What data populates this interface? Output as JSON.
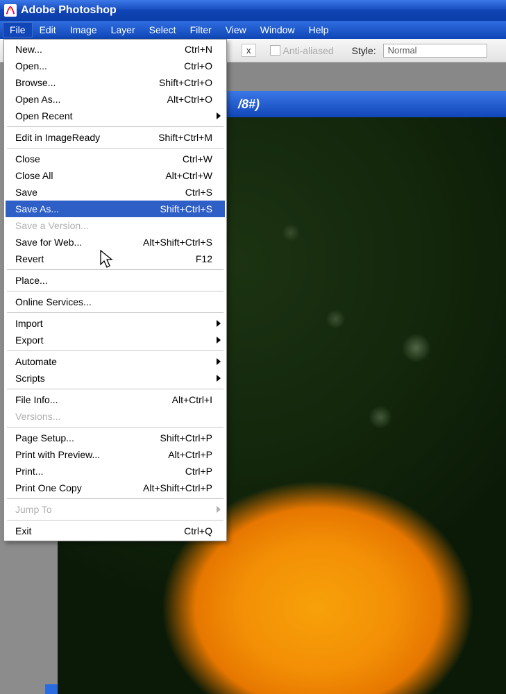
{
  "app": {
    "title": "Adobe Photoshop"
  },
  "menubar": {
    "items": [
      "File",
      "Edit",
      "Image",
      "Layer",
      "Select",
      "Filter",
      "View",
      "Window",
      "Help"
    ],
    "open_index": 0
  },
  "options": {
    "px_suffix": "x",
    "anti_aliased_label": "Anti-aliased",
    "anti_aliased_checked": false,
    "style_label": "Style:",
    "style_value": "Normal"
  },
  "document": {
    "tab_visible_text": "/8#)"
  },
  "file_menu": {
    "groups": [
      [
        {
          "label": "New...",
          "shortcut": "Ctrl+N",
          "submenu": false,
          "disabled": false
        },
        {
          "label": "Open...",
          "shortcut": "Ctrl+O",
          "submenu": false,
          "disabled": false
        },
        {
          "label": "Browse...",
          "shortcut": "Shift+Ctrl+O",
          "submenu": false,
          "disabled": false
        },
        {
          "label": "Open As...",
          "shortcut": "Alt+Ctrl+O",
          "submenu": false,
          "disabled": false
        },
        {
          "label": "Open Recent",
          "shortcut": "",
          "submenu": true,
          "disabled": false
        }
      ],
      [
        {
          "label": "Edit in ImageReady",
          "shortcut": "Shift+Ctrl+M",
          "submenu": false,
          "disabled": false
        }
      ],
      [
        {
          "label": "Close",
          "shortcut": "Ctrl+W",
          "submenu": false,
          "disabled": false
        },
        {
          "label": "Close All",
          "shortcut": "Alt+Ctrl+W",
          "submenu": false,
          "disabled": false
        },
        {
          "label": "Save",
          "shortcut": "Ctrl+S",
          "submenu": false,
          "disabled": false
        },
        {
          "label": "Save As...",
          "shortcut": "Shift+Ctrl+S",
          "submenu": false,
          "disabled": false,
          "highlight": true
        },
        {
          "label": "Save a Version...",
          "shortcut": "",
          "submenu": false,
          "disabled": true
        },
        {
          "label": "Save for Web...",
          "shortcut": "Alt+Shift+Ctrl+S",
          "submenu": false,
          "disabled": false
        },
        {
          "label": "Revert",
          "shortcut": "F12",
          "submenu": false,
          "disabled": false
        }
      ],
      [
        {
          "label": "Place...",
          "shortcut": "",
          "submenu": false,
          "disabled": false
        }
      ],
      [
        {
          "label": "Online Services...",
          "shortcut": "",
          "submenu": false,
          "disabled": false
        }
      ],
      [
        {
          "label": "Import",
          "shortcut": "",
          "submenu": true,
          "disabled": false
        },
        {
          "label": "Export",
          "shortcut": "",
          "submenu": true,
          "disabled": false
        }
      ],
      [
        {
          "label": "Automate",
          "shortcut": "",
          "submenu": true,
          "disabled": false
        },
        {
          "label": "Scripts",
          "shortcut": "",
          "submenu": true,
          "disabled": false
        }
      ],
      [
        {
          "label": "File Info...",
          "shortcut": "Alt+Ctrl+I",
          "submenu": false,
          "disabled": false
        },
        {
          "label": "Versions...",
          "shortcut": "",
          "submenu": false,
          "disabled": true
        }
      ],
      [
        {
          "label": "Page Setup...",
          "shortcut": "Shift+Ctrl+P",
          "submenu": false,
          "disabled": false
        },
        {
          "label": "Print with Preview...",
          "shortcut": "Alt+Ctrl+P",
          "submenu": false,
          "disabled": false
        },
        {
          "label": "Print...",
          "shortcut": "Ctrl+P",
          "submenu": false,
          "disabled": false
        },
        {
          "label": "Print One Copy",
          "shortcut": "Alt+Shift+Ctrl+P",
          "submenu": false,
          "disabled": false
        }
      ],
      [
        {
          "label": "Jump To",
          "shortcut": "",
          "submenu": true,
          "disabled": true
        }
      ],
      [
        {
          "label": "Exit",
          "shortcut": "Ctrl+Q",
          "submenu": false,
          "disabled": false
        }
      ]
    ]
  }
}
